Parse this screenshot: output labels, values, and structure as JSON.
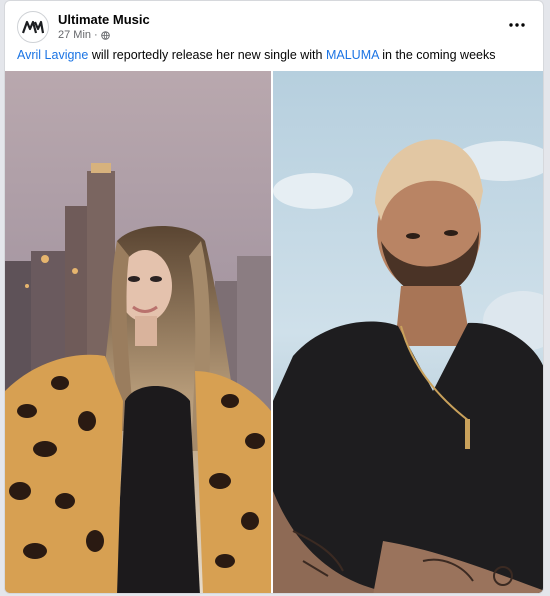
{
  "post": {
    "page_name": "Ultimate Music",
    "timestamp": "27 Min",
    "dot": "·",
    "avatar_logo": "UM",
    "more_icon": "more-horizontal-icon",
    "privacy_icon": "globe-icon",
    "caption": {
      "link1": "Avril Lavigne",
      "middle": " will reportedly release her new single with ",
      "link2": "MALUMA",
      "end": " in the coming weeks"
    },
    "photos": [
      {
        "subject": "avril-lavigne-photo"
      },
      {
        "subject": "maluma-photo"
      }
    ]
  },
  "colors": {
    "link": "#1b74e4",
    "text": "#050505",
    "meta": "#65676b",
    "card_bg": "#ffffff"
  }
}
